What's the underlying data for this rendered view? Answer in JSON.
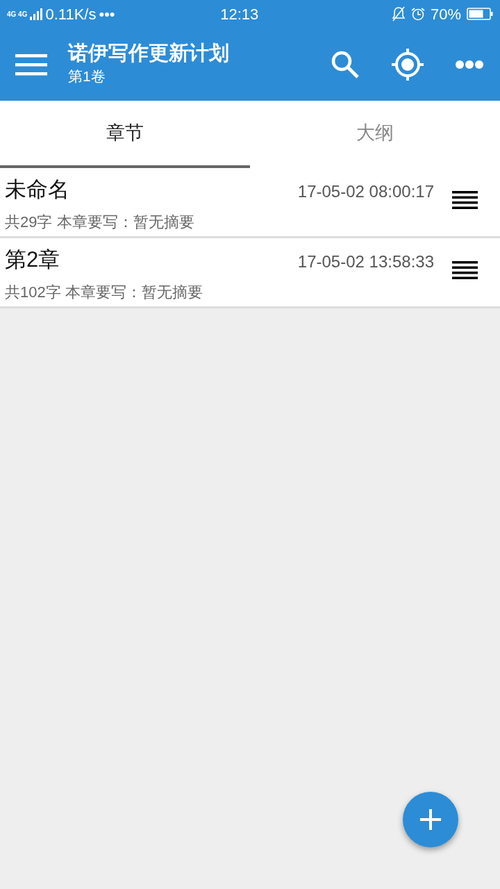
{
  "status_bar": {
    "network": "4G 4G",
    "speed": "0.11K/s",
    "more": "•••",
    "time": "12:13",
    "battery": "70%"
  },
  "toolbar": {
    "title": "诺伊写作更新计划",
    "subtitle": "第1卷"
  },
  "tabs": [
    {
      "label": "章节",
      "selected": true
    },
    {
      "label": "大纲",
      "selected": false
    }
  ],
  "chapters": [
    {
      "title": "未命名",
      "time": "17-05-02 08:00:17",
      "summary": "共29字 本章要写：暂无摘要"
    },
    {
      "title": "第2章",
      "time": "17-05-02 13:58:33",
      "summary": "共102字 本章要写：暂无摘要"
    }
  ]
}
